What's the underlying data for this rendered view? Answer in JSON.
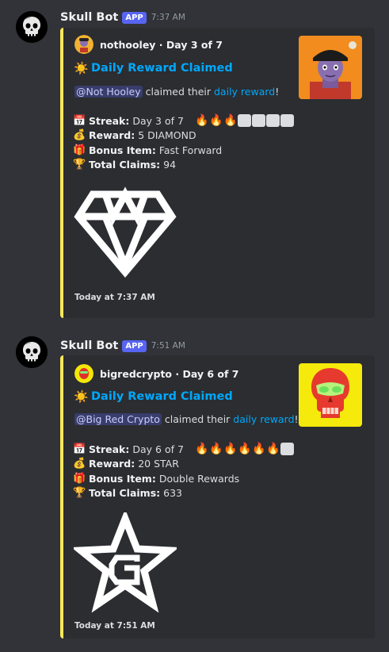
{
  "messages": [
    {
      "bot_name": "Skull Bot",
      "badge": "APP",
      "time": "7:37 AM",
      "embed": {
        "author": "nothooley · Day 3 of 7",
        "title": "Daily Reward Claimed",
        "mention": "@Not Hooley",
        "desc_middle": "claimed their",
        "desc_link": "daily reward",
        "desc_end": "!",
        "fields": {
          "streak_label": "Streak:",
          "streak_value": "Day 3 of 7",
          "reward_label": "Reward:",
          "reward_value": "5 DIAMOND",
          "bonus_label": "Bonus Item:",
          "bonus_value": "Fast Forward",
          "claims_label": "Total Claims:",
          "claims_value": "94"
        },
        "streak_filled": 3,
        "streak_total": 7,
        "image_icon": "diamond-icon",
        "footer": "Today at 7:37 AM"
      }
    },
    {
      "bot_name": "Skull Bot",
      "badge": "APP",
      "time": "7:51 AM",
      "embed": {
        "author": "bigredcrypto · Day 6 of 7",
        "title": "Daily Reward Claimed",
        "mention": "@Big Red Crypto",
        "desc_middle": "claimed their",
        "desc_link": "daily reward",
        "desc_end": "!",
        "fields": {
          "streak_label": "Streak:",
          "streak_value": "Day 6 of 7",
          "reward_label": "Reward:",
          "reward_value": "20 STAR",
          "bonus_label": "Bonus Item:",
          "bonus_value": "Double Rewards",
          "claims_label": "Total Claims:",
          "claims_value": "633"
        },
        "streak_filled": 6,
        "streak_total": 7,
        "image_icon": "star-g-icon",
        "footer": "Today at 7:51 AM"
      }
    }
  ],
  "icons": {
    "sun": "☀️",
    "calendar": "📅",
    "money_bag": "💰",
    "gift": "🎁",
    "trophy": "🏆",
    "fire": "🔥"
  },
  "colors": {
    "embed_accent": "#fee75c",
    "link": "#00a8fc",
    "app_badge": "#5865f2",
    "background": "#313338",
    "embed_bg": "#2b2d31"
  }
}
